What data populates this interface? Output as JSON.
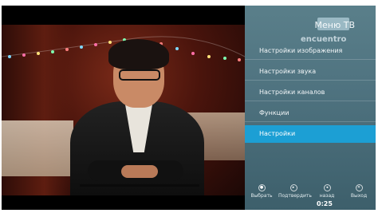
{
  "menu": {
    "title": "Меню ТВ",
    "watermark": "encuentro",
    "items": [
      {
        "label": "Настройки изображения",
        "selected": false
      },
      {
        "label": "Настройки звука",
        "selected": false
      },
      {
        "label": "Настройки каналов",
        "selected": false
      },
      {
        "label": "Функции",
        "selected": false
      },
      {
        "label": "Настройки",
        "selected": true
      }
    ],
    "controls": [
      {
        "label": "Выбрать",
        "icon": "ok-icon"
      },
      {
        "label": "Подтвердить",
        "icon": "enter-icon"
      },
      {
        "label": "назад",
        "icon": "back-icon"
      },
      {
        "label": "Выход",
        "icon": "exit-icon"
      }
    ],
    "timer": "0:25"
  },
  "colors": {
    "panel": "#4f7380",
    "selected": "#1c9fd4",
    "background": "#000000"
  }
}
